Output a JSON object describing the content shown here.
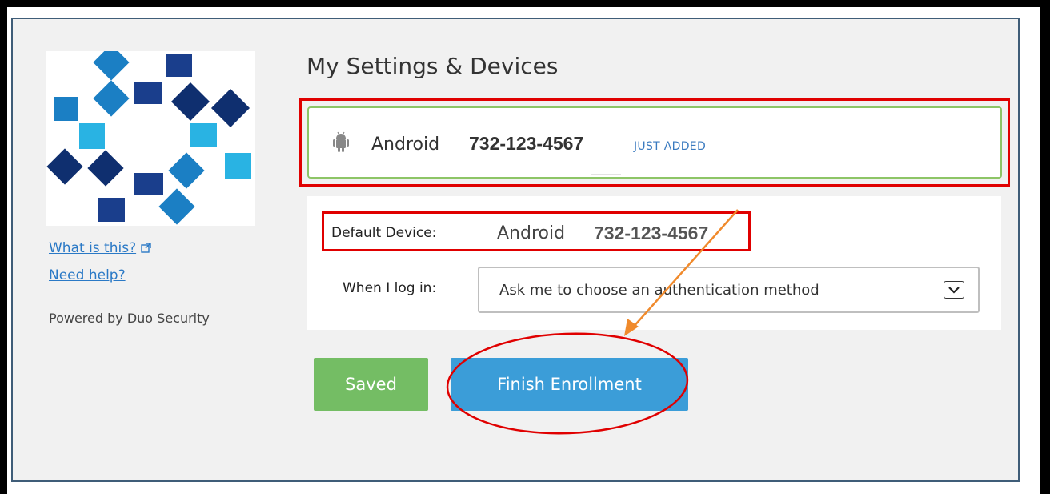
{
  "header": {
    "title": "My Settings & Devices"
  },
  "sidebar": {
    "what_is_this": "What is this?",
    "need_help": "Need help?",
    "powered_by": "Powered by Duo Security"
  },
  "device": {
    "name": "Android",
    "number": "732-123-4567",
    "badge": "JUST ADDED",
    "icon": "android-icon"
  },
  "settings": {
    "default_label": "Default Device:",
    "default_name": "Android",
    "default_number": "732-123-4567",
    "login_label": "When I log in:",
    "login_option": "Ask me to choose an authentication method"
  },
  "buttons": {
    "saved": "Saved",
    "finish": "Finish Enrollment"
  },
  "colors": {
    "saved_green": "#74bd64",
    "finish_blue": "#3b9dd8",
    "highlight_red": "#e00000",
    "arrow_orange": "#f08a2c",
    "link_blue": "#2a79c6"
  }
}
